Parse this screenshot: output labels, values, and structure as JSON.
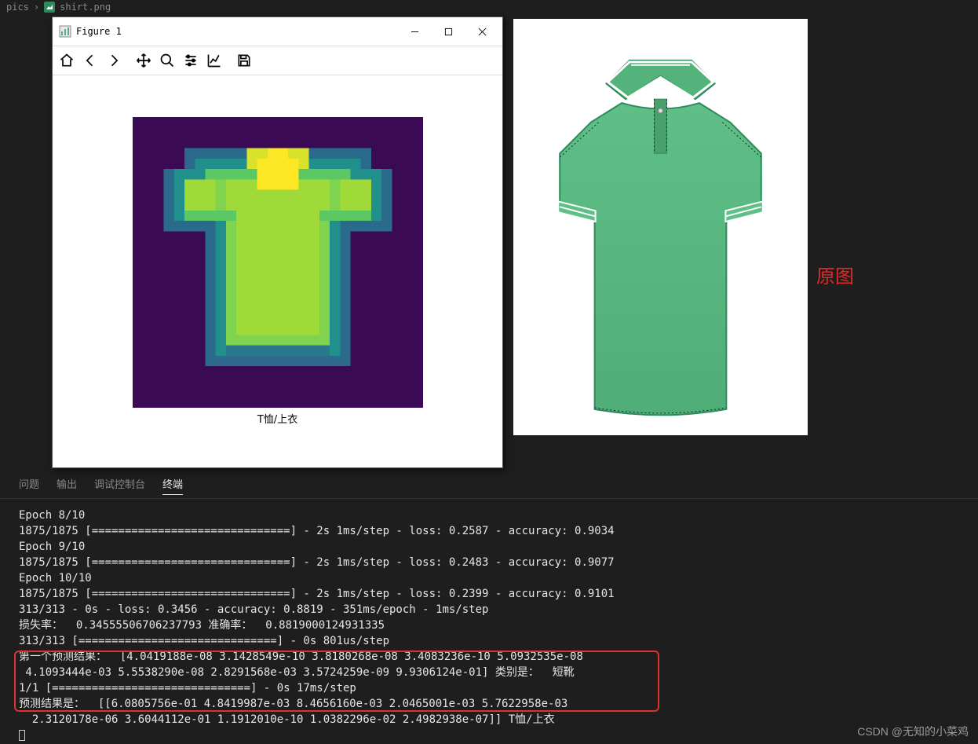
{
  "breadcrumb": {
    "folder": "pics",
    "file": "shirt.png"
  },
  "figure": {
    "title": "Figure 1",
    "caption": "T恤/上衣"
  },
  "original_label": "原图",
  "tabs": {
    "problems": "问题",
    "output": "输出",
    "debug_console": "调试控制台",
    "terminal": "终端"
  },
  "terminal_lines": [
    "Epoch 8/10",
    "1875/1875 [==============================] - 2s 1ms/step - loss: 0.2587 - accuracy: 0.9034",
    "Epoch 9/10",
    "1875/1875 [==============================] - 2s 1ms/step - loss: 0.2483 - accuracy: 0.9077",
    "Epoch 10/10",
    "1875/1875 [==============================] - 2s 1ms/step - loss: 0.2399 - accuracy: 0.9101",
    "313/313 - 0s - loss: 0.3456 - accuracy: 0.8819 - 351ms/epoch - 1ms/step",
    "损失率：  0.34555506706237793 准确率：  0.8819000124931335",
    "313/313 [==============================] - 0s 801us/step",
    "第一个预测结果：  [4.0419188e-08 3.1428549e-10 3.8180268e-08 3.4083236e-10 5.0932535e-08",
    " 4.1093444e-03 5.5538290e-08 2.8291568e-03 3.5724259e-09 9.9306124e-01] 类别是：  短靴",
    "1/1 [==============================] - 0s 17ms/step",
    "预测结果是：  [[6.0805756e-01 4.8419987e-03 8.4656160e-03 2.0465001e-03 5.7622958e-03",
    "  2.3120178e-06 3.6044112e-01 1.1912010e-10 1.0382296e-02 2.4982938e-07]] T恤/上衣"
  ],
  "watermark": "CSDN @无知的小菜鸡"
}
